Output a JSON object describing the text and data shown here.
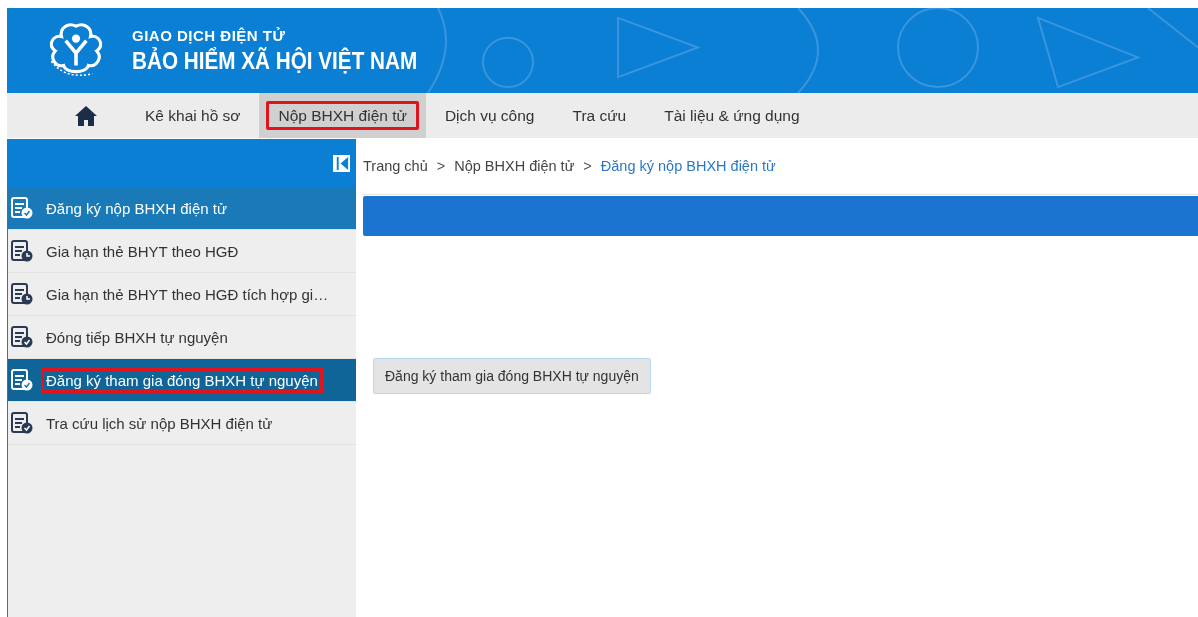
{
  "header": {
    "subtitle": "GIAO DỊCH ĐIỆN TỬ",
    "title": "BẢO HIỂM XÃ HỘI VIỆT NAM"
  },
  "nav": [
    {
      "label": "Kê khai hồ sơ",
      "selected": false,
      "highlighted": false
    },
    {
      "label": "Nộp BHXH điện tử",
      "selected": true,
      "highlighted": true
    },
    {
      "label": "Dịch vụ công",
      "selected": false,
      "highlighted": false
    },
    {
      "label": "Tra cứu",
      "selected": false,
      "highlighted": false
    },
    {
      "label": "Tài liệu & ứng dụng",
      "selected": false,
      "highlighted": false
    }
  ],
  "sidebar": {
    "items": [
      {
        "label": "Đăng ký nộp BHXH điện tử",
        "kind": "check",
        "selected": true,
        "hovered": false,
        "highlighted": false
      },
      {
        "label": "Gia hạn thẻ BHYT theo HGĐ",
        "kind": "clock",
        "selected": false,
        "hovered": false,
        "highlighted": false
      },
      {
        "label": "Gia hạn thẻ BHYT theo HGĐ tích hợp gi…",
        "kind": "clock",
        "selected": false,
        "hovered": false,
        "highlighted": false
      },
      {
        "label": "Đóng tiếp BHXH tự nguyện",
        "kind": "check",
        "selected": false,
        "hovered": false,
        "highlighted": false
      },
      {
        "label": "Đăng ký tham gia đóng BHXH tự nguyện",
        "kind": "check",
        "selected": false,
        "hovered": true,
        "highlighted": true
      },
      {
        "label": "Tra cứu lịch sử nộp BHXH điện tử",
        "kind": "check",
        "selected": false,
        "hovered": false,
        "highlighted": false
      }
    ]
  },
  "breadcrumb": [
    {
      "label": "Trang chủ",
      "current": false
    },
    {
      "label": "Nộp BHXH điện tử",
      "current": false
    },
    {
      "label": "Đăng ký nộp BHXH điện tử",
      "current": true
    }
  ],
  "breadcrumb_separator": ">",
  "action_button": "Đăng ký tham gia đóng BHXH tự nguyện"
}
